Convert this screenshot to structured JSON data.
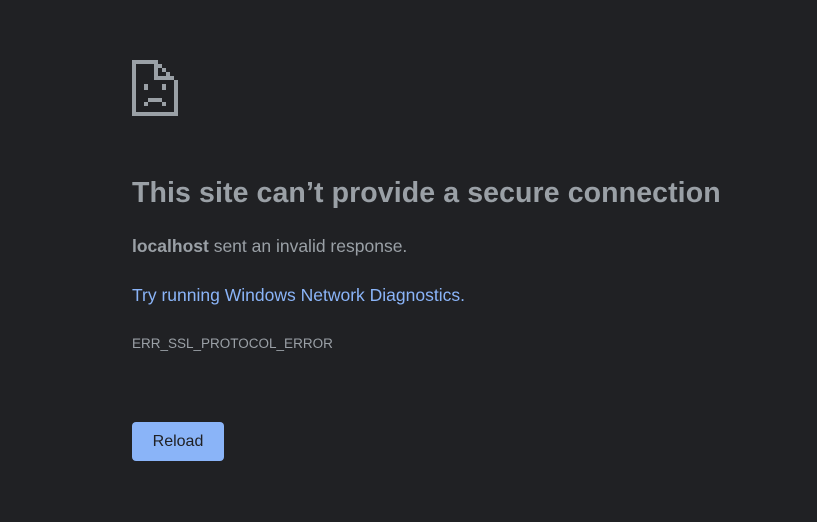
{
  "error_page": {
    "icon": "sad-document-icon",
    "title": "This site can’t provide a secure connection",
    "message_host": "localhost",
    "message_text": " sent an invalid response.",
    "suggestion_prefix": "Try running ",
    "suggestion_link": "Windows Network Diagnostics",
    "suggestion_suffix": ".",
    "error_code": "ERR_SSL_PROTOCOL_ERROR",
    "reload_label": "Reload"
  },
  "colors": {
    "background": "#202124",
    "text": "#9aa0a6",
    "link": "#8ab4f8",
    "button_bg": "#8ab4f8",
    "button_text": "#202124"
  }
}
